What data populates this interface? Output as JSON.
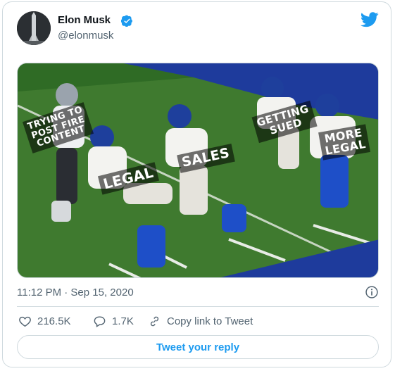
{
  "tweet": {
    "display_name": "Elon Musk",
    "handle": "@elonmusk",
    "timestamp": "11:12 PM · Sep 15, 2020",
    "likes": "216.5K",
    "replies": "1.7K",
    "copy_link_label": "Copy link to Tweet",
    "reply_button_label": "Tweet your reply"
  },
  "meme": {
    "label_trying": "TRYING TO\nPOST FIRE\nCONTENT",
    "label_legal": "LEGAL",
    "label_sales": "SALES",
    "label_sued": "GETTING\nSUED",
    "label_more_legal": "MORE\nLEGAL"
  },
  "colors": {
    "brand_blue": "#1d9bf0",
    "field_green": "#3f7a2f",
    "end_zone_blue": "#1e3b9c"
  }
}
